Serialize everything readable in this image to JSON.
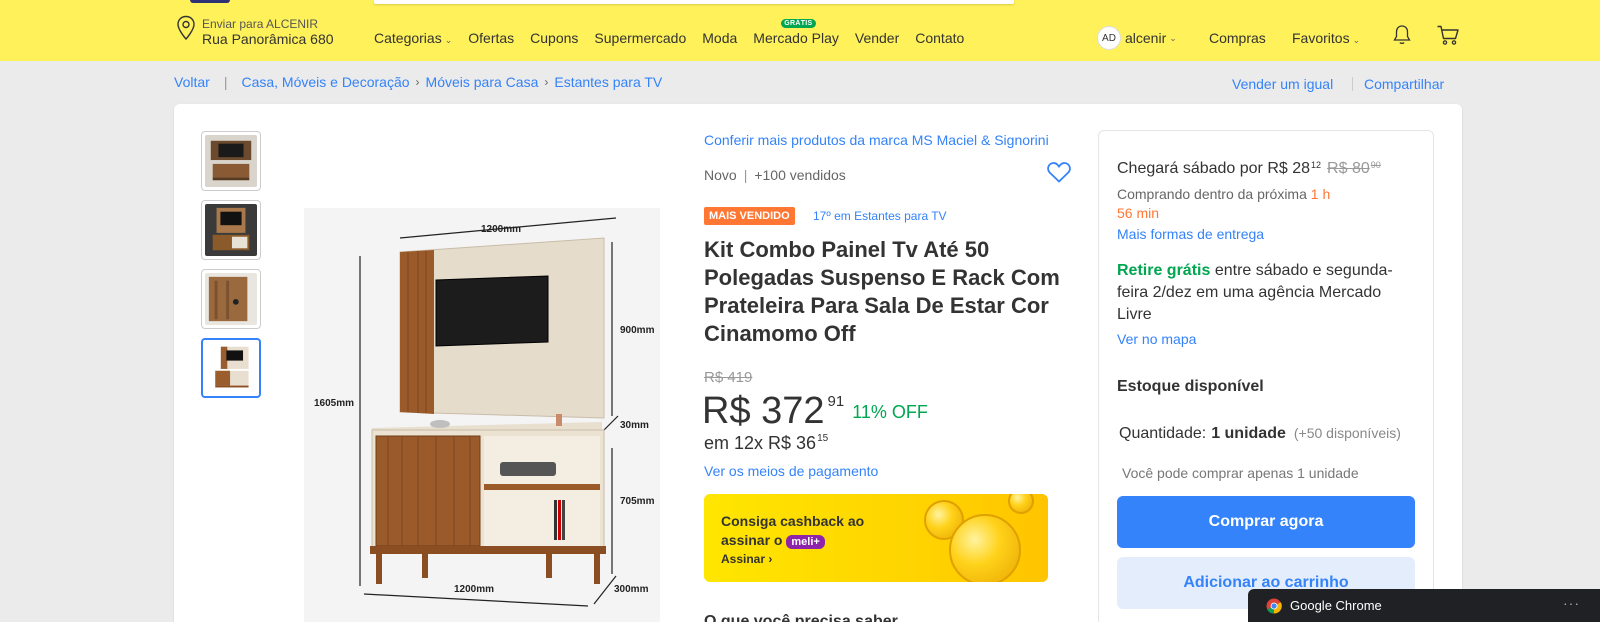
{
  "header": {
    "location_label": "Enviar para ALCENIR",
    "location_address": "Rua Panorâmica 680",
    "nav": [
      {
        "label": "Categorias",
        "dropdown": true
      },
      {
        "label": "Ofertas"
      },
      {
        "label": "Cupons"
      },
      {
        "label": "Supermercado"
      },
      {
        "label": "Moda"
      },
      {
        "label": "Mercado Play",
        "badge": "GRÁTIS"
      },
      {
        "label": "Vender"
      },
      {
        "label": "Contato"
      }
    ],
    "user_initials": "AD",
    "user_name": "alcenir",
    "compras": "Compras",
    "favoritos": "Favoritos",
    "bg_color": "#fff159"
  },
  "breadcrumb": {
    "back": "Voltar",
    "items": [
      "Casa, Móveis e Decoração",
      "Móveis para Casa",
      "Estantes para TV"
    ],
    "sell_same": "Vender um igual",
    "share": "Compartilhar"
  },
  "gallery": {
    "thumbnails": 4,
    "active_index": 3,
    "dimensions": {
      "top_width": "1200mm",
      "panel_height": "900mm",
      "total_height": "1605mm",
      "depth_panel": "30mm",
      "rack_height": "705mm",
      "bottom_width": "1200mm",
      "depth_rack": "300mm"
    }
  },
  "product": {
    "brand_link": "Conferir mais produtos da marca MS Maciel & Signorini",
    "condition": "Novo",
    "sold": "+100 vendidos",
    "best_seller_badge": "MAIS VENDIDO",
    "rank": "17º em Estantes para TV",
    "title": "Kit Combo Painel Tv Até 50 Polegadas Suspenso E Rack Com Prateleira Para Sala De Estar Cor Cinamomo Off",
    "old_price": "R$ 419",
    "price": "R$ 372",
    "price_cents": "91",
    "discount": "11% OFF",
    "installments": "em 12x R$ 36",
    "installments_cents": "15",
    "payment_link": "Ver os meios de pagamento",
    "cashback_line1": "Consiga cashback ao",
    "cashback_line2": "assinar o",
    "cashback_brand": "meli+",
    "cashback_link": "Assinar"
  },
  "shipping": {
    "arrival": "Chegará sábado por R$ 28",
    "arrival_cents": "12",
    "original_shipping": "R$ 80",
    "original_cents": "90",
    "cutoff_prefix": "Comprando dentro da próxima",
    "cutoff_time_1": "1 h",
    "cutoff_time_2": "56 min",
    "more_options": "Mais formas de entrega",
    "pickup_green": "Retire grátis",
    "pickup_rest": "entre sábado e segunda-feira 2/dez em uma agência Mercado Livre",
    "map_link": "Ver no mapa",
    "stock": "Estoque disponível",
    "qty_label": "Quantidade:",
    "qty_value": "1 unidade",
    "qty_available": "(+50 disponíveis)",
    "limit": "Você pode comprar apenas 1 unidade",
    "buy_button": "Comprar agora",
    "cart_button": "Adicionar ao carrinho",
    "accent_color": "#3483fa"
  },
  "bottom_peek": "O que você precisa saber",
  "chrome_notification": {
    "title": "Google Chrome",
    "menu": "···"
  }
}
